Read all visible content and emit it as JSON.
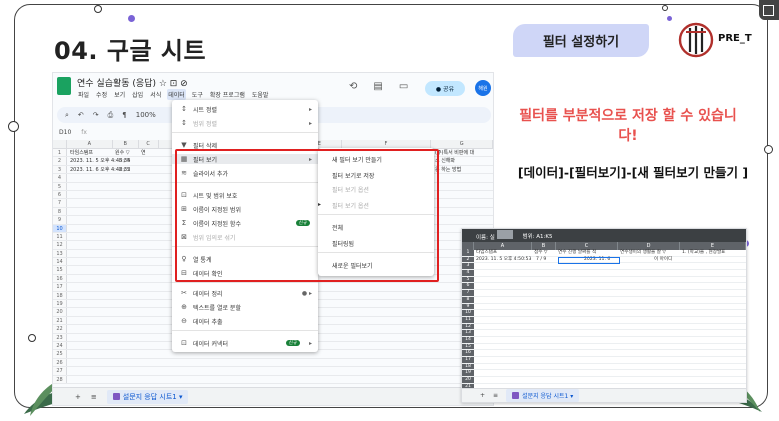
{
  "slide": {
    "title": "04. 구글 시트",
    "badge": "필터 설정하기",
    "logo_text": "PRE_T",
    "note_red": "필터를 부분적으로 저장 할 수 있습니다!",
    "note_path": "[데이터]-[필터보기]-[새 필터보기 만들기 ]"
  },
  "colors": {
    "accent_red": "#e8514e",
    "badge_bg": "#cfd6f7",
    "highlight_box": "#e02020",
    "deco_purple": "#7a63d6"
  },
  "sheet": {
    "doc_title": "연수 실습활동 (응답)  ☆ ⊡ ⊘",
    "menus": [
      "파일",
      "수정",
      "보기",
      "삽입",
      "서식",
      "데이터",
      "도구",
      "확장 프로그램",
      "도움말"
    ],
    "active_menu": "데이터",
    "share_label": "● 공유",
    "avatar_label": "해원",
    "toolbar": {
      "zoom": "100%",
      "name_box": "D10",
      "fx": "fx"
    },
    "columns": [
      "A",
      "B",
      "C",
      "D",
      "E",
      "F",
      "G"
    ],
    "header_row": {
      "a": "타임스탬프",
      "b": "원수 ▽",
      "c": "연",
      "g": "(주)특서 비판에 대"
    },
    "row2": {
      "a": "2023. 11. 5 오후 4:48:34",
      "b": "5 / 5",
      "g": "소 신해봐"
    },
    "row3": {
      "a": "2023. 11. 6 오후 4:48:32",
      "b": "2 / 5",
      "g": "응 하는 방법"
    },
    "row_numbers": [
      "1",
      "2",
      "3",
      "4",
      "5",
      "6",
      "7",
      "8",
      "9",
      "10",
      "11",
      "12",
      "13",
      "14",
      "15",
      "16",
      "17",
      "18",
      "19",
      "20",
      "21",
      "22",
      "23",
      "24",
      "25",
      "26",
      "27",
      "28"
    ],
    "selected_row": "10",
    "tab_label": "설문지 응답 시트1 ▾",
    "tab_add": "+",
    "tab_list": "≡"
  },
  "menu_data": {
    "items": [
      {
        "icon": "↕",
        "label": "시트 정렬",
        "arrow": "▸",
        "dim": false
      },
      {
        "icon": "↕",
        "label": "범위 정렬",
        "arrow": "▸",
        "dim": true
      },
      {
        "icon": "▼",
        "label": "필터 삭제",
        "dim": false
      },
      {
        "icon": "▦",
        "label": "필터 보기",
        "arrow": "▸",
        "dim": false,
        "highlight": true
      },
      {
        "icon": "≋",
        "label": "슬라이서 추가",
        "dim": false
      },
      {
        "icon": "⊡",
        "label": "시트 및 범위 보호",
        "dim": false
      },
      {
        "icon": "⊞",
        "label": "이름이 지정된 범위",
        "dim": false
      },
      {
        "icon": "Σ",
        "label": "이름이 지정된 함수",
        "badge": "신규",
        "dim": false
      },
      {
        "icon": "⊠",
        "label": "범위 임의로 섞기",
        "dim": true
      },
      {
        "icon": "♀",
        "label": "열 통계",
        "dim": false
      },
      {
        "icon": "⊟",
        "label": "데이터 확인",
        "dim": false
      },
      {
        "icon": "✂",
        "label": "데이터 정리",
        "arrow": "● ▸",
        "dim": false
      },
      {
        "icon": "⊕",
        "label": "텍스트를 열로 분할",
        "dim": false
      },
      {
        "icon": "⊖",
        "label": "데이터 추출",
        "dim": false
      },
      {
        "icon": "⊡",
        "label": "데이터 커넥터",
        "badge": "신규",
        "arrow": "▸",
        "dim": false
      }
    ]
  },
  "submenu": {
    "items": [
      {
        "label": "새 필터 보기 만들기",
        "dim": false
      },
      {
        "label": "필터 보기로 저장",
        "dim": false
      },
      {
        "label": "필터 보기 옵션",
        "dim": true
      },
      {
        "label": "필터 보기 옵션",
        "arrow": "▸",
        "dim": true
      },
      {
        "label": "전체",
        "dim": false
      },
      {
        "label": "필터링됨",
        "dim": false
      },
      {
        "label": "새로운 필터보기",
        "dim": false
      }
    ]
  },
  "sheet2": {
    "top": [
      "이름: 실",
      "범위: A1:K5"
    ],
    "columns": [
      "A",
      "B",
      "C",
      "D",
      "E"
    ],
    "header": {
      "a": "타임스탬프",
      "b": "점수 ▽",
      "c": "연수 진행 날짜를 적",
      "d": "연수생이의 생활을 잘 ▽",
      "e": "1. (학교)을 , 현장발표"
    },
    "row2": {
      "a": "2023. 11. 5 오후 4:50:53",
      "b": "7 / 9",
      "c": "2023. 11. 6",
      "d": "이 아이디",
      "e": ""
    },
    "row_numbers": [
      "1",
      "2",
      "3",
      "4",
      "5",
      "6",
      "7",
      "8",
      "9",
      "10",
      "11",
      "12",
      "13",
      "14",
      "15",
      "16",
      "17",
      "18",
      "19",
      "20",
      "21"
    ],
    "tab_label": "설문지 응답 시트1 ▾"
  }
}
